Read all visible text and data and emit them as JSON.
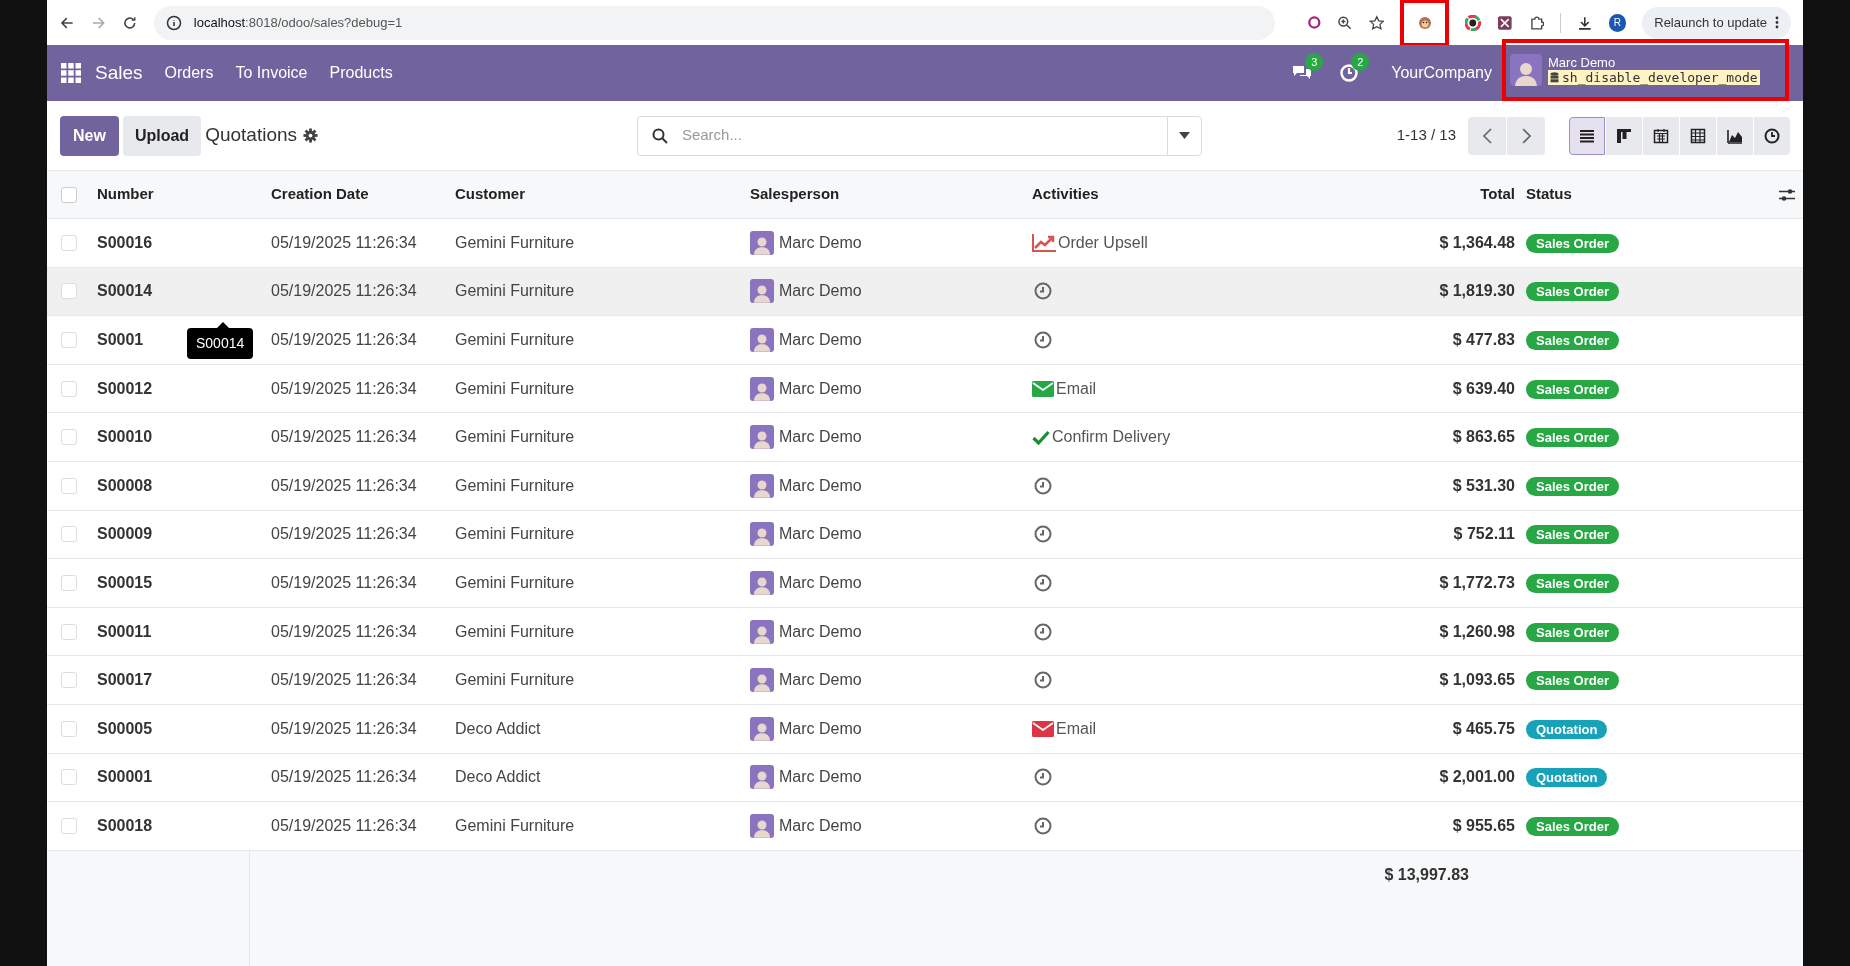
{
  "browser": {
    "url_host": "localhost",
    "url_rest": ":8018/odoo/sales?debug=1",
    "profile_initial": "R",
    "relaunch": "Relaunch to update"
  },
  "navbar": {
    "app": "Sales",
    "menus": [
      "Orders",
      "To Invoice",
      "Products"
    ],
    "messages_count": "3",
    "activities_count": "2",
    "company": "YourCompany",
    "user": "Marc Demo",
    "database": "sh_disable_developer_mode"
  },
  "control_panel": {
    "new": "New",
    "upload": "Upload",
    "title": "Quotations",
    "search_placeholder": "Search...",
    "pager": "1-13 / 13",
    "views": [
      {
        "kind": "list",
        "selected": true
      },
      {
        "kind": "kanban",
        "selected": false
      },
      {
        "kind": "calendar",
        "selected": false
      },
      {
        "kind": "pivot",
        "selected": false
      },
      {
        "kind": "graph",
        "selected": false
      },
      {
        "kind": "activity",
        "selected": false
      }
    ]
  },
  "table": {
    "select_all_checked": false,
    "columns": [
      "Number",
      "Creation Date",
      "Customer",
      "Salesperson",
      "Activities",
      "Total",
      "Status"
    ],
    "rows": [
      {
        "checked": false,
        "number": "S00016",
        "date": "05/19/2025 11:26:34",
        "customer": "Gemini Furniture",
        "salesperson": "Marc Demo",
        "activity": {
          "kind": "upsell",
          "label": "Order Upsell",
          "color": "#d9534f"
        },
        "total": "$ 1,364.48",
        "status": {
          "kind": "sale",
          "label": "Sales Order"
        },
        "hovered": false
      },
      {
        "checked": false,
        "number": "S00014",
        "date": "05/19/2025 11:26:34",
        "customer": "Gemini Furniture",
        "salesperson": "Marc Demo",
        "activity": {
          "kind": "none"
        },
        "total": "$ 1,819.30",
        "status": {
          "kind": "sale",
          "label": "Sales Order"
        },
        "hovered": true
      },
      {
        "checked": false,
        "number": "S0001",
        "date": "05/19/2025 11:26:34",
        "customer": "Gemini Furniture",
        "salesperson": "Marc Demo",
        "activity": {
          "kind": "none"
        },
        "total": "$ 477.83",
        "status": {
          "kind": "sale",
          "label": "Sales Order"
        },
        "hovered": false
      },
      {
        "checked": false,
        "number": "S00012",
        "date": "05/19/2025 11:26:34",
        "customer": "Gemini Furniture",
        "salesperson": "Marc Demo",
        "activity": {
          "kind": "email",
          "label": "Email",
          "color": "#28a745"
        },
        "total": "$ 639.40",
        "status": {
          "kind": "sale",
          "label": "Sales Order"
        },
        "hovered": false
      },
      {
        "checked": false,
        "number": "S00010",
        "date": "05/19/2025 11:26:34",
        "customer": "Gemini Furniture",
        "salesperson": "Marc Demo",
        "activity": {
          "kind": "check",
          "label": "Confirm Delivery",
          "color": "#1e8a3a"
        },
        "total": "$ 863.65",
        "status": {
          "kind": "sale",
          "label": "Sales Order"
        },
        "hovered": false
      },
      {
        "checked": false,
        "number": "S00008",
        "date": "05/19/2025 11:26:34",
        "customer": "Gemini Furniture",
        "salesperson": "Marc Demo",
        "activity": {
          "kind": "none"
        },
        "total": "$ 531.30",
        "status": {
          "kind": "sale",
          "label": "Sales Order"
        },
        "hovered": false
      },
      {
        "checked": false,
        "number": "S00009",
        "date": "05/19/2025 11:26:34",
        "customer": "Gemini Furniture",
        "salesperson": "Marc Demo",
        "activity": {
          "kind": "none"
        },
        "total": "$ 752.11",
        "status": {
          "kind": "sale",
          "label": "Sales Order"
        },
        "hovered": false
      },
      {
        "checked": false,
        "number": "S00015",
        "date": "05/19/2025 11:26:34",
        "customer": "Gemini Furniture",
        "salesperson": "Marc Demo",
        "activity": {
          "kind": "none"
        },
        "total": "$ 1,772.73",
        "status": {
          "kind": "sale",
          "label": "Sales Order"
        },
        "hovered": false
      },
      {
        "checked": false,
        "number": "S00011",
        "date": "05/19/2025 11:26:34",
        "customer": "Gemini Furniture",
        "salesperson": "Marc Demo",
        "activity": {
          "kind": "none"
        },
        "total": "$ 1,260.98",
        "status": {
          "kind": "sale",
          "label": "Sales Order"
        },
        "hovered": false
      },
      {
        "checked": false,
        "number": "S00017",
        "date": "05/19/2025 11:26:34",
        "customer": "Gemini Furniture",
        "salesperson": "Marc Demo",
        "activity": {
          "kind": "none"
        },
        "total": "$ 1,093.65",
        "status": {
          "kind": "sale",
          "label": "Sales Order"
        },
        "hovered": false
      },
      {
        "checked": false,
        "number": "S00005",
        "date": "05/19/2025 11:26:34",
        "customer": "Deco Addict",
        "salesperson": "Marc Demo",
        "activity": {
          "kind": "email",
          "label": "Email",
          "color": "#dc3545"
        },
        "total": "$ 465.75",
        "status": {
          "kind": "quotation",
          "label": "Quotation"
        },
        "hovered": false
      },
      {
        "checked": false,
        "number": "S00001",
        "date": "05/19/2025 11:26:34",
        "customer": "Deco Addict",
        "salesperson": "Marc Demo",
        "activity": {
          "kind": "none"
        },
        "total": "$ 2,001.00",
        "status": {
          "kind": "quotation",
          "label": "Quotation"
        },
        "hovered": false
      },
      {
        "checked": false,
        "number": "S00018",
        "date": "05/19/2025 11:26:34",
        "customer": "Gemini Furniture",
        "salesperson": "Marc Demo",
        "activity": {
          "kind": "none"
        },
        "total": "$ 955.65",
        "status": {
          "kind": "sale",
          "label": "Sales Order"
        },
        "hovered": false
      }
    ],
    "grand_total": "$ 13,997.83"
  },
  "tooltip": "S00014"
}
